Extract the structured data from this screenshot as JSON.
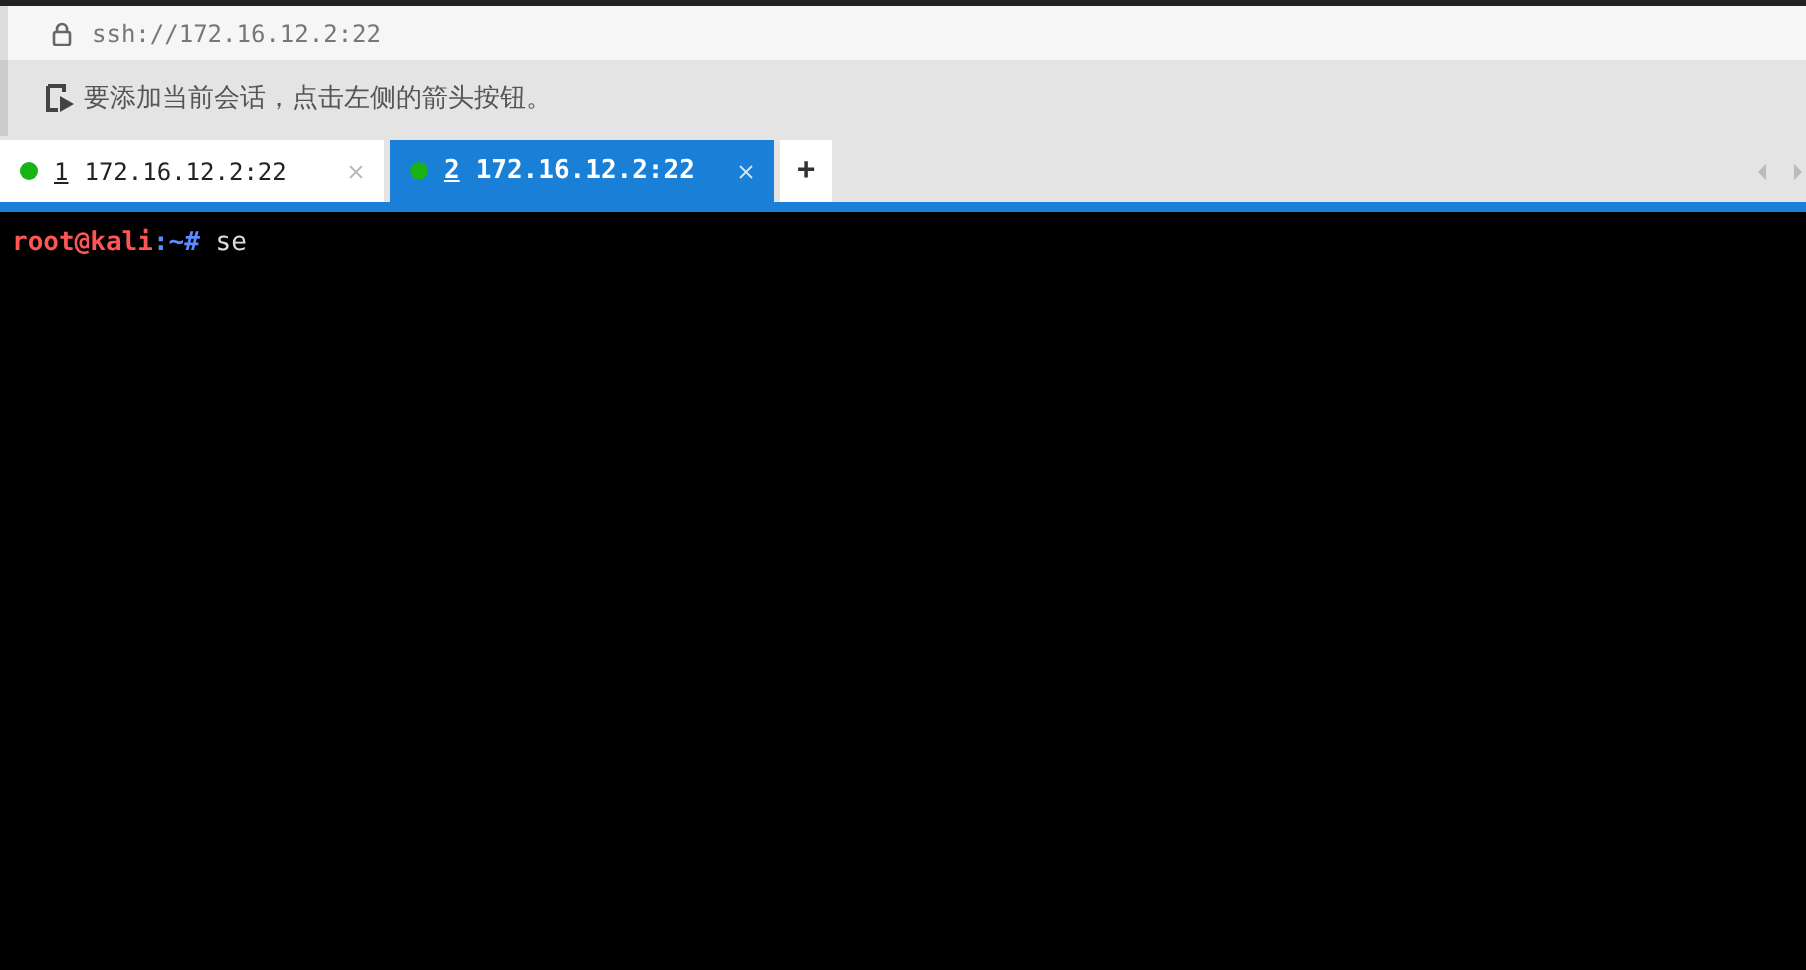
{
  "address_bar": {
    "url": "ssh://172.16.12.2:22"
  },
  "hint_bar": {
    "text": "要添加当前会话，点击左侧的箭头按钮。"
  },
  "tabs": [
    {
      "number": "1",
      "label": "172.16.12.2:22",
      "selected": false,
      "connected": true
    },
    {
      "number": "2",
      "label": "172.16.12.2:22",
      "selected": true,
      "connected": true
    }
  ],
  "new_tab_button": "+",
  "terminal": {
    "lines": [
      {
        "user_host": "root@kali",
        "path": ":~#",
        "command": "se"
      }
    ]
  }
}
